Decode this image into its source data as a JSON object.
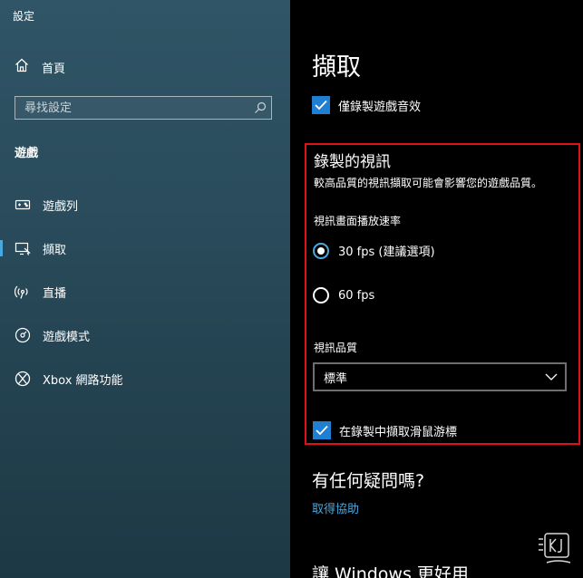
{
  "app": {
    "title": "設定"
  },
  "sidebar": {
    "home_label": "首頁",
    "search_placeholder": "尋找設定",
    "section_header": "遊戲",
    "items": [
      {
        "label": "遊戲列",
        "icon": "game-bar-icon",
        "selected": false
      },
      {
        "label": "擷取",
        "icon": "captures-icon",
        "selected": true
      },
      {
        "label": "直播",
        "icon": "broadcasting-icon",
        "selected": false
      },
      {
        "label": "遊戲模式",
        "icon": "game-mode-icon",
        "selected": false
      },
      {
        "label": "Xbox 網路功能",
        "icon": "xbox-icon",
        "selected": false
      }
    ]
  },
  "main": {
    "title": "擷取",
    "record_game_audio_only": {
      "label": "僅錄製遊戲音效",
      "checked": true
    },
    "recorded_video": {
      "heading": "錄製的視訊",
      "description": "較高品質的視訊擷取可能會影響您的遊戲品質。",
      "frame_rate_label": "視訊畫面播放速率",
      "frame_rate_options": [
        {
          "label": "30 fps (建議選項)",
          "checked": true
        },
        {
          "label": "60 fps",
          "checked": false
        }
      ],
      "quality_label": "視訊品質",
      "quality_value": "標準",
      "capture_cursor": {
        "label": "在錄製中擷取滑鼠游標",
        "checked": true
      }
    },
    "help": {
      "heading": "有任何疑問嗎?",
      "link": "取得協助"
    },
    "improve_heading": "讓 Windows 更好用"
  },
  "colors": {
    "accent": "#1f7fd3",
    "link": "#4aa8e0",
    "highlight_border": "#e0111b",
    "sidebar_bg": "#2a4c5c",
    "main_bg": "#000000"
  }
}
